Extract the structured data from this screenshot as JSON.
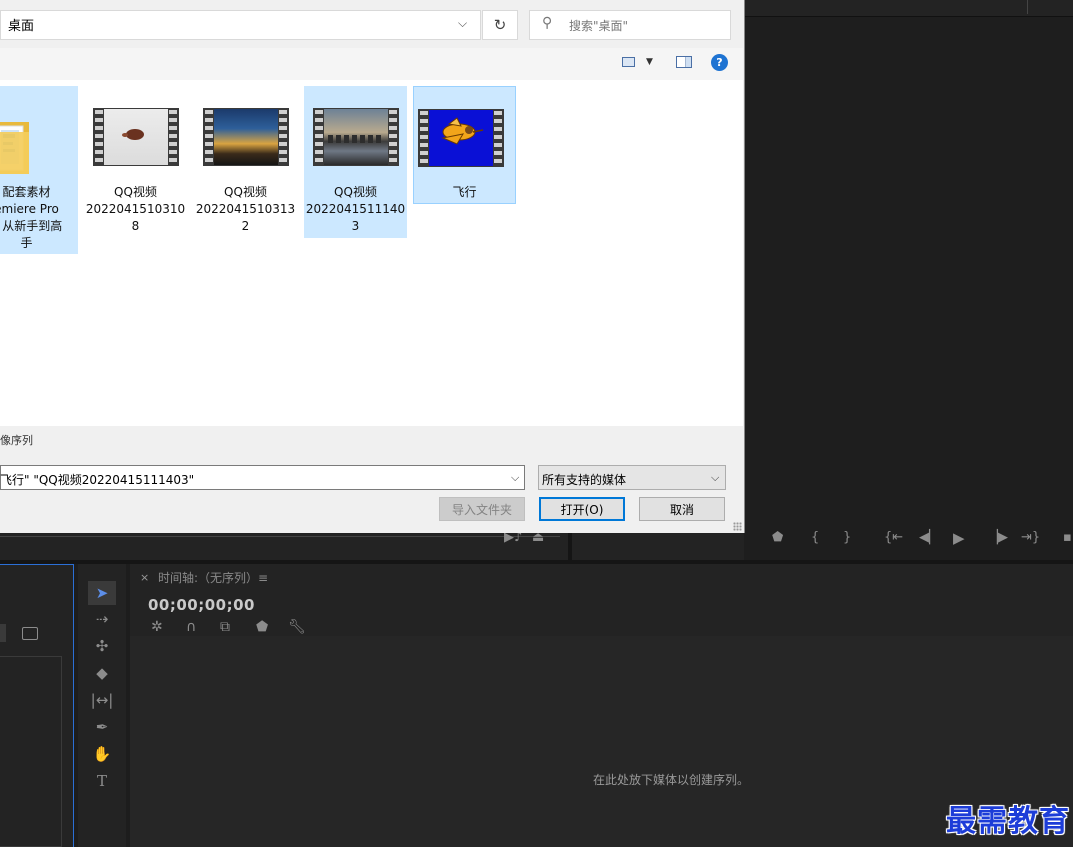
{
  "dialog": {
    "address": "桌面",
    "search_placeholder": "搜索\"桌面\"",
    "status_label": "像序列",
    "filename_value": "飞行\" \"QQ视频20220415111403\"",
    "filetype_value": "所有支持的媒体",
    "import_folder_label": "导入文件夹",
    "open_label": "打开(O)",
    "cancel_label": "取消",
    "help_label": "?"
  },
  "files": [
    {
      "name": "配套素材\nemiere Pro\n0 从新手到高\n手",
      "kind": "folder",
      "selected": true
    },
    {
      "name": "QQ视频\n2022041510310\n8",
      "kind": "video",
      "selected": false
    },
    {
      "name": "QQ视频\n2022041510313\n2",
      "kind": "video",
      "selected": false
    },
    {
      "name": "QQ视频\n2022041511140\n3",
      "kind": "video",
      "selected": true
    },
    {
      "name": "飞行",
      "kind": "video",
      "selected": true
    }
  ],
  "premiere": {
    "timeline_tab": "时间轴:（无序列）≡",
    "timecode": "00;00;00;00",
    "empty_hint": "在此处放下媒体以创建序列。"
  },
  "watermark": "最需教育"
}
